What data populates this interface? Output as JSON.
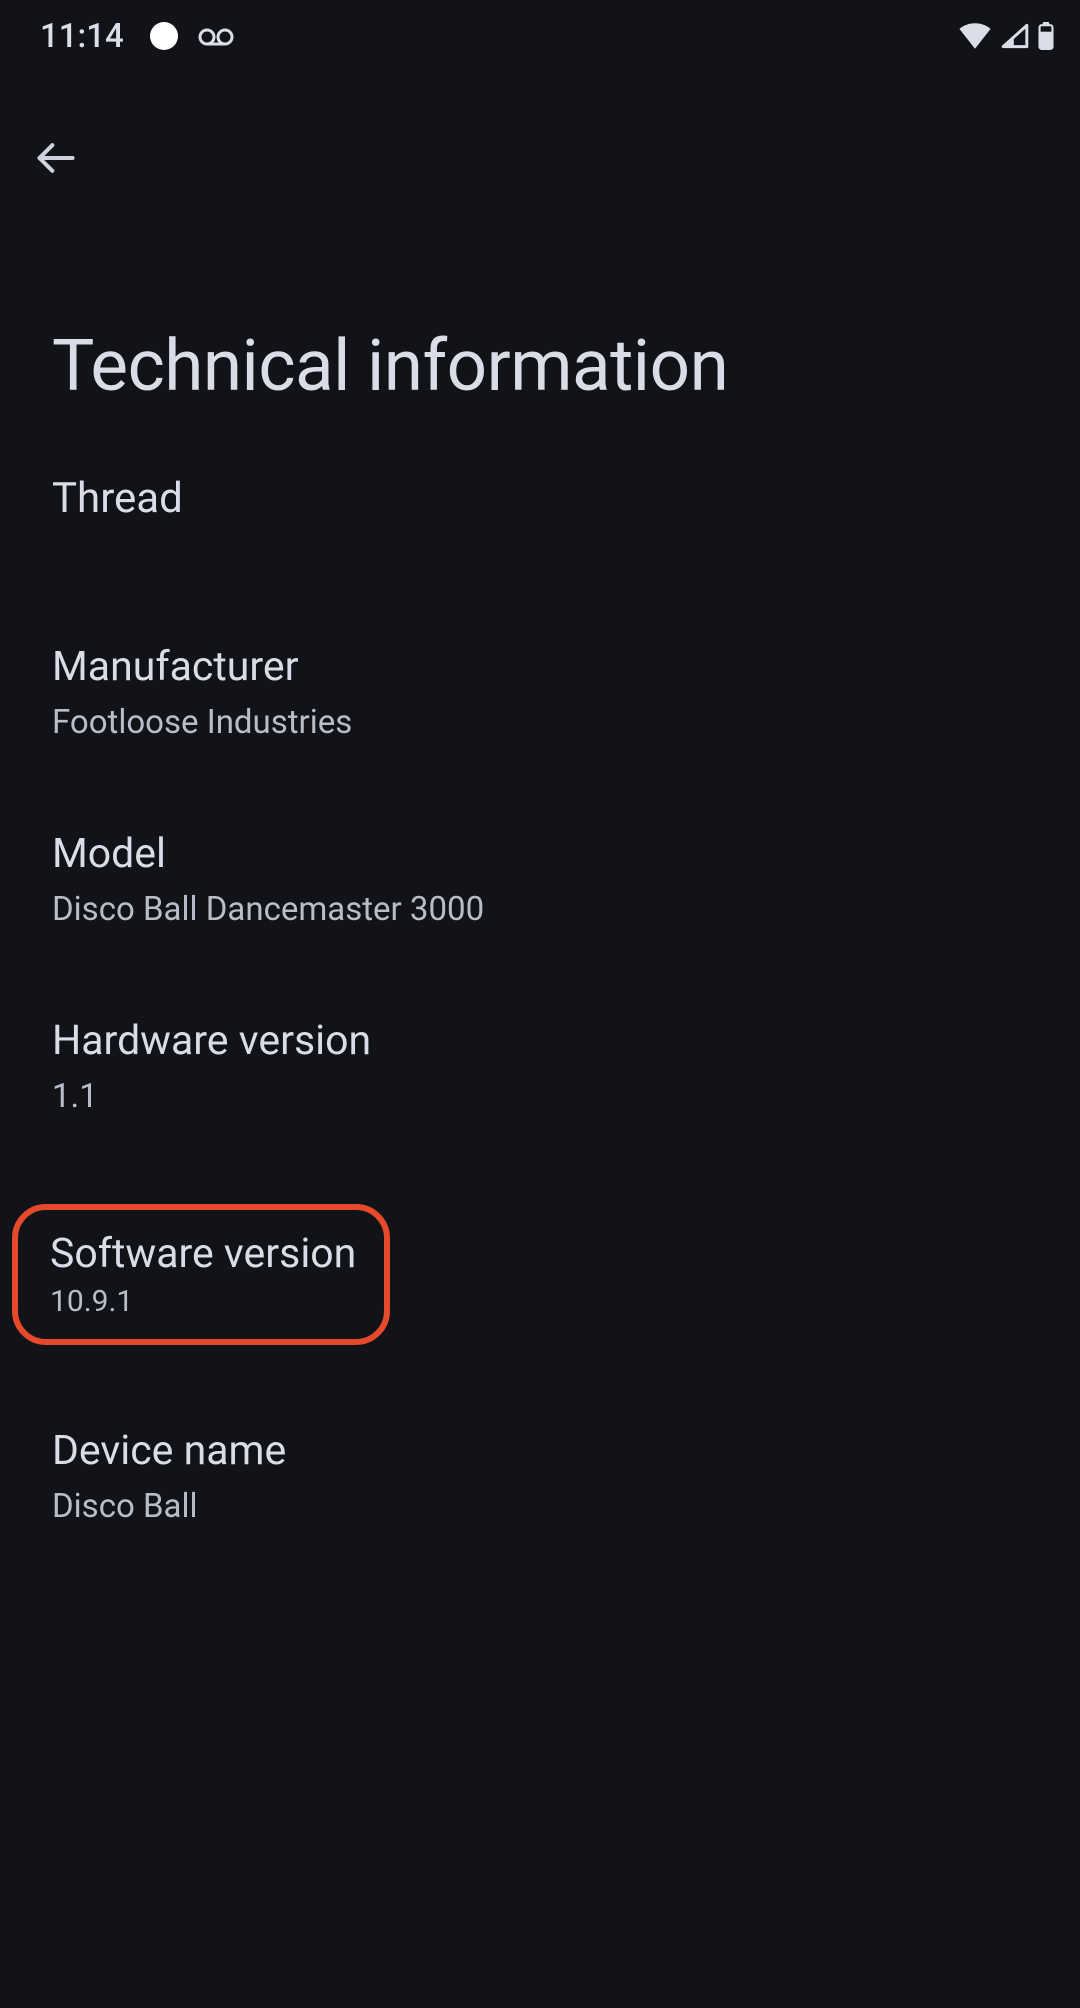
{
  "status": {
    "time": "11:14"
  },
  "page": {
    "title": "Technical information",
    "section": "Thread"
  },
  "info": {
    "manufacturer": {
      "label": "Manufacturer",
      "value": "Footloose Industries"
    },
    "model": {
      "label": "Model",
      "value": "Disco Ball Dancemaster 3000"
    },
    "hardware": {
      "label": "Hardware version",
      "value": "1.1"
    },
    "software": {
      "label": "Software version",
      "value": "10.9.1"
    },
    "devicename": {
      "label": "Device name",
      "value": "Disco Ball"
    }
  }
}
